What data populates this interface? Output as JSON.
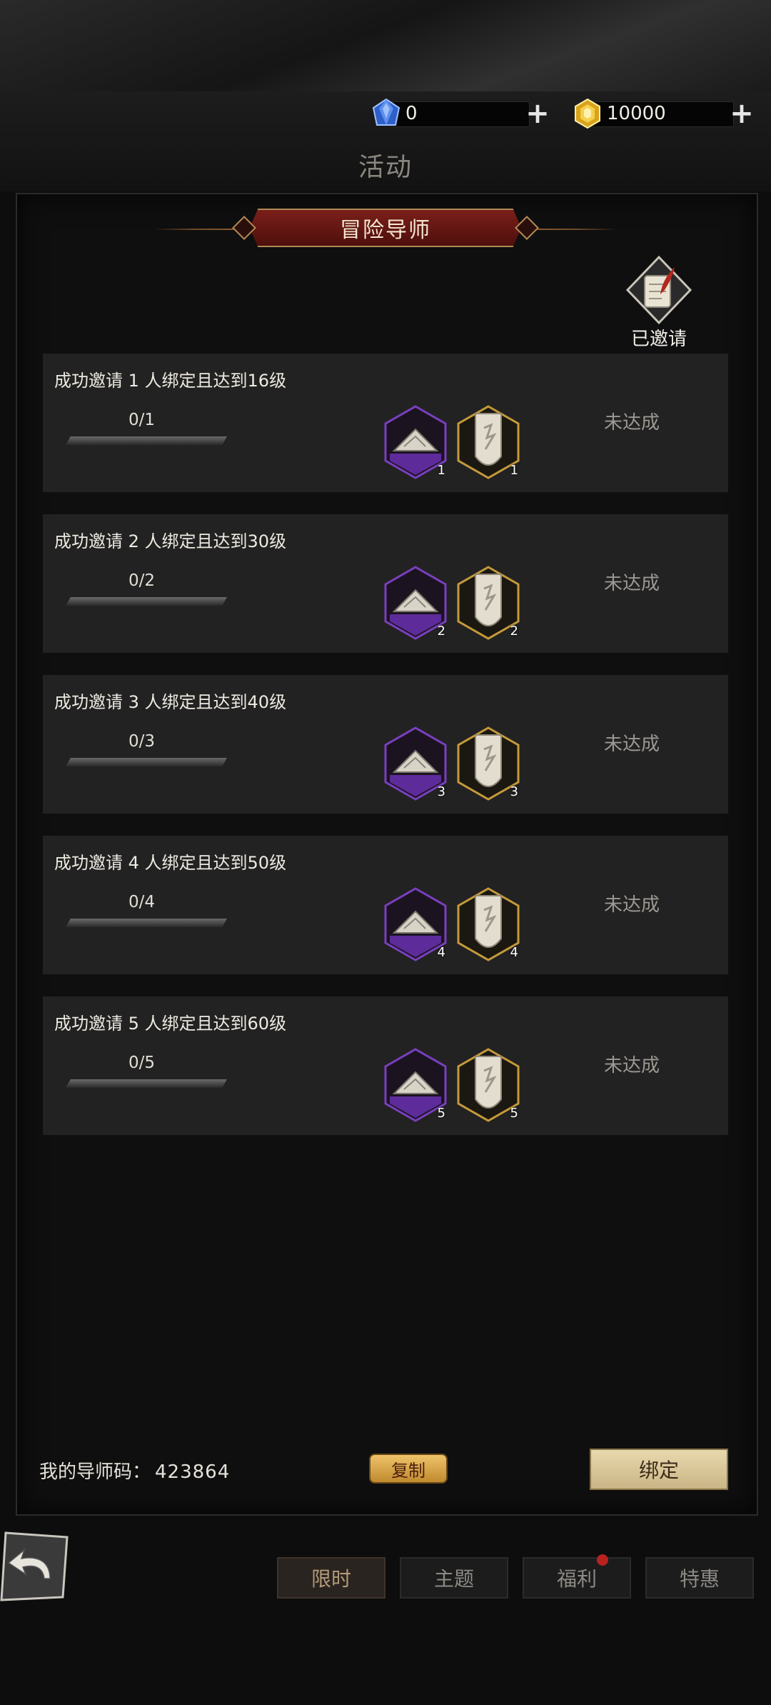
{
  "currencies": [
    {
      "icon": "blue-diamond-icon",
      "amount": "0",
      "color": "#3b6fd6"
    },
    {
      "icon": "gold-gem-icon",
      "amount": "10000",
      "color": "#e2b326"
    }
  ],
  "page_title": "活动",
  "banner_title": "冒险导师",
  "invited_label": "已邀请",
  "tasks": [
    {
      "desc": "成功邀请 1 人绑定且达到16级",
      "progress": "0/1",
      "fraction": 0,
      "reward1_count": "1",
      "reward2_count": "1",
      "status": "未达成"
    },
    {
      "desc": "成功邀请 2 人绑定且达到30级",
      "progress": "0/2",
      "fraction": 0,
      "reward1_count": "2",
      "reward2_count": "2",
      "status": "未达成"
    },
    {
      "desc": "成功邀请 3 人绑定且达到40级",
      "progress": "0/3",
      "fraction": 0,
      "reward1_count": "3",
      "reward2_count": "3",
      "status": "未达成"
    },
    {
      "desc": "成功邀请 4 人绑定且达到50级",
      "progress": "0/4",
      "fraction": 0,
      "reward1_count": "4",
      "reward2_count": "4",
      "status": "未达成"
    },
    {
      "desc": "成功邀请 5 人绑定且达到60级",
      "progress": "0/5",
      "fraction": 0,
      "reward1_count": "5",
      "reward2_count": "5",
      "status": "未达成"
    }
  ],
  "mentor_code_label": "我的导师码：",
  "mentor_code": "423864",
  "copy_label": "复制",
  "bind_label": "绑定",
  "tabs": [
    {
      "label": "限时",
      "active": true
    },
    {
      "label": "主题",
      "active": false
    },
    {
      "label": "福利",
      "active": false,
      "badge": true
    },
    {
      "label": "特惠",
      "active": false
    }
  ]
}
